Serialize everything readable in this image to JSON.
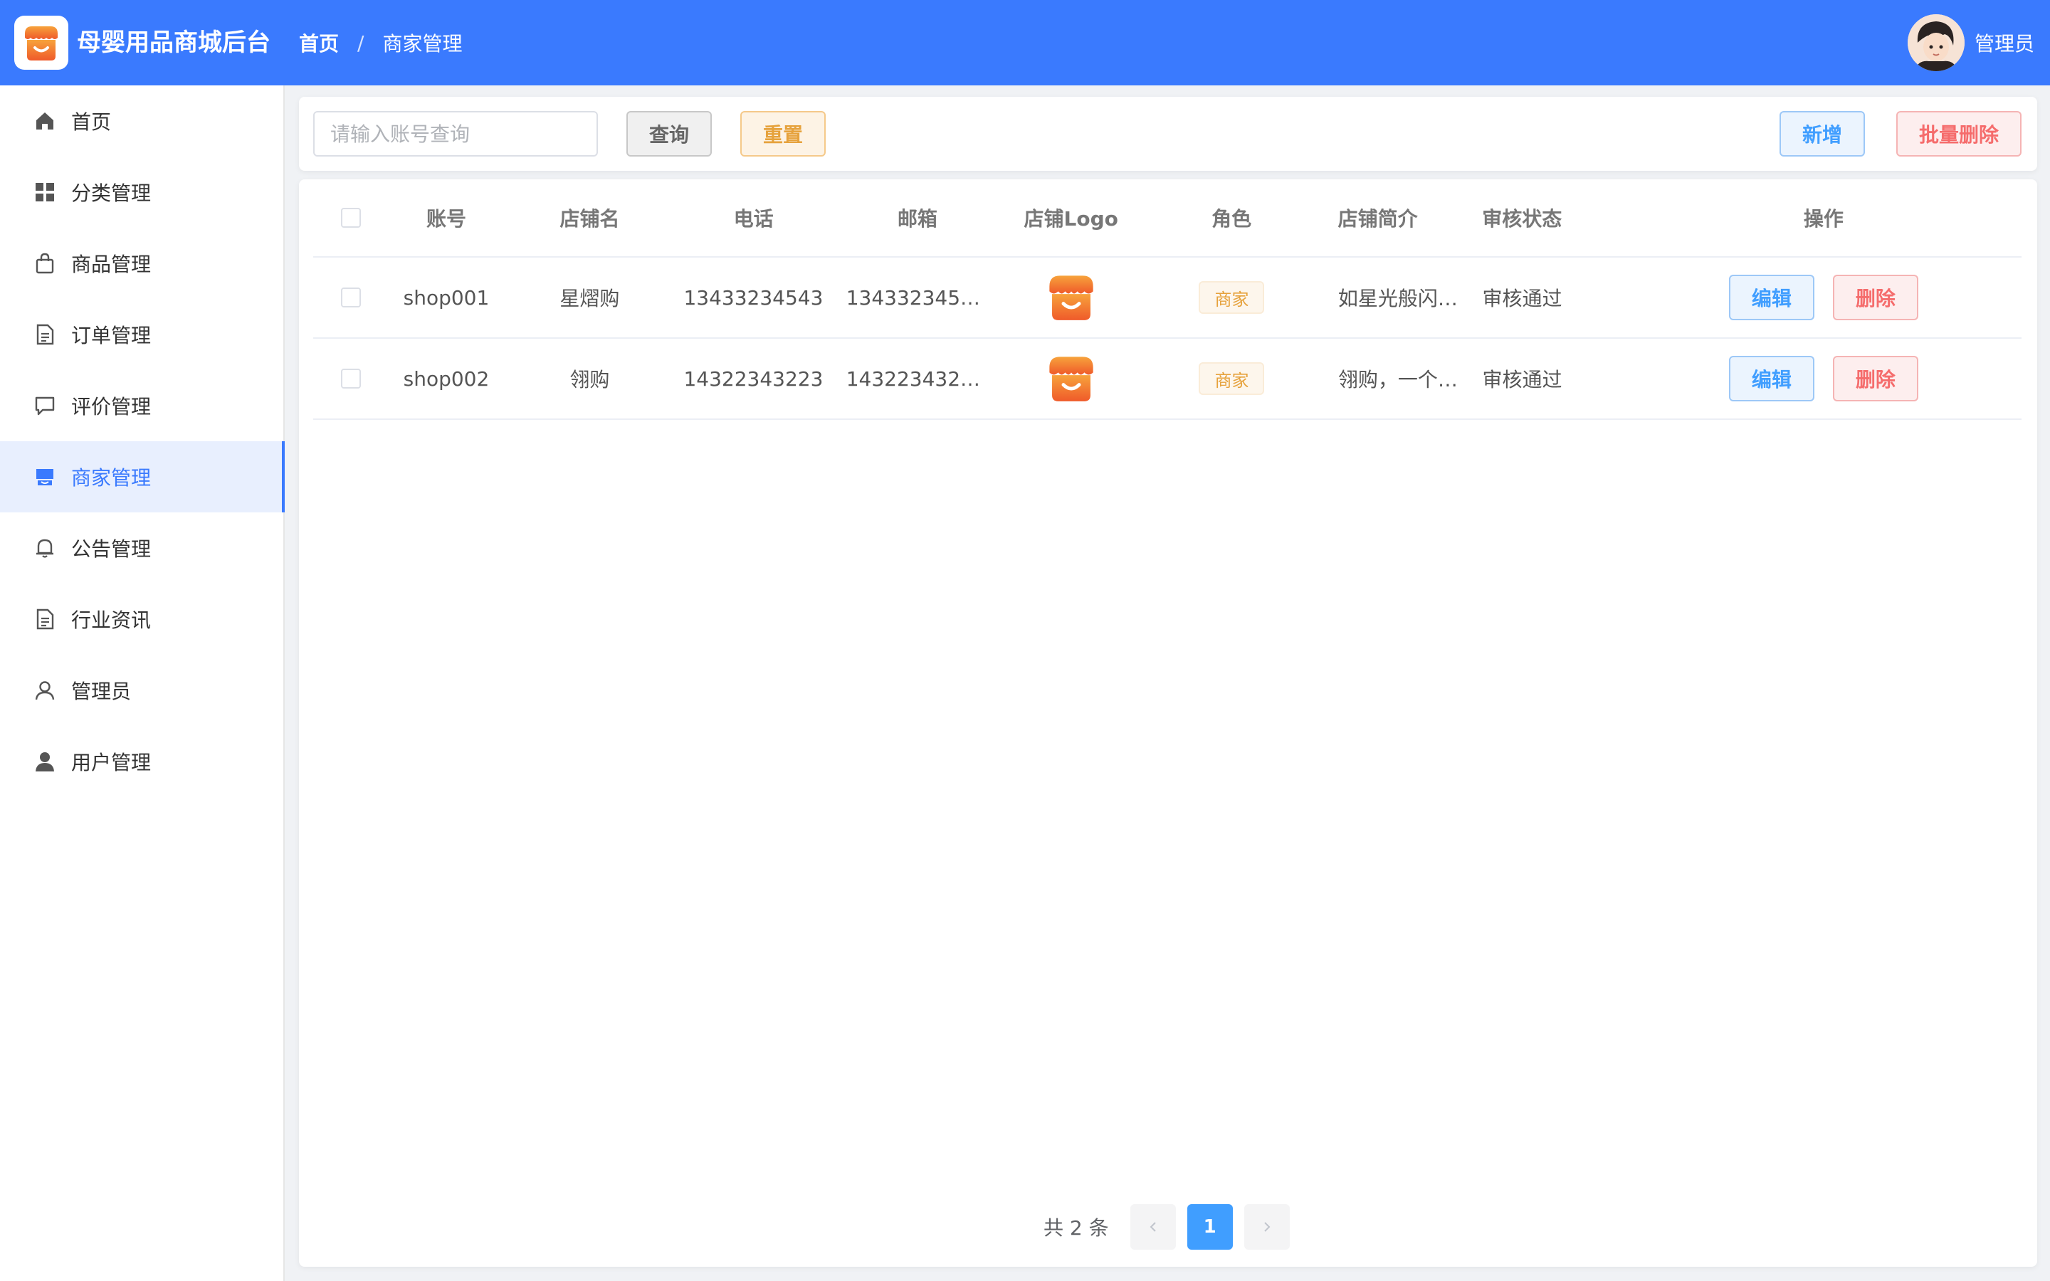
{
  "header": {
    "app_title": "母婴用品商城后台",
    "breadcrumb": [
      "首页",
      "商家管理"
    ],
    "separator": "/",
    "user_name": "管理员",
    "brand_color": "#3a7afe"
  },
  "sidebar": {
    "items": [
      {
        "label": "首页",
        "icon": "home-icon"
      },
      {
        "label": "分类管理",
        "icon": "grid-icon"
      },
      {
        "label": "商品管理",
        "icon": "bag-icon"
      },
      {
        "label": "订单管理",
        "icon": "document-icon"
      },
      {
        "label": "评价管理",
        "icon": "comment-icon"
      },
      {
        "label": "商家管理",
        "icon": "shop-icon",
        "active": true
      },
      {
        "label": "公告管理",
        "icon": "bell-icon"
      },
      {
        "label": "行业资讯",
        "icon": "news-icon"
      },
      {
        "label": "管理员",
        "icon": "user-icon"
      },
      {
        "label": "用户管理",
        "icon": "user-filled-icon"
      }
    ]
  },
  "search": {
    "placeholder": "请输入账号查询",
    "value": "",
    "query_label": "查询",
    "reset_label": "重置",
    "add_label": "新增",
    "batch_delete_label": "批量删除"
  },
  "table": {
    "columns": [
      "账号",
      "店铺名",
      "电话",
      "邮箱",
      "店铺Logo",
      "角色",
      "店铺简介",
      "审核状态",
      "操作"
    ],
    "rows": [
      {
        "account": "shop001",
        "shop_name": "星熠购",
        "phone": "13433234543",
        "email": "134332345…",
        "role": "商家",
        "intro": "如星光般闪…",
        "status": "审核通过",
        "edit": "编辑",
        "delete": "删除"
      },
      {
        "account": "shop002",
        "shop_name": "翎购",
        "phone": "14322343223",
        "email": "143223432…",
        "role": "商家",
        "intro": "翎购，一个…",
        "status": "审核通过",
        "edit": "编辑",
        "delete": "删除"
      }
    ]
  },
  "pagination": {
    "total_text": "共 2 条",
    "current_page": "1",
    "prev_icon": "chevron-left-icon",
    "next_icon": "chevron-right-icon"
  }
}
